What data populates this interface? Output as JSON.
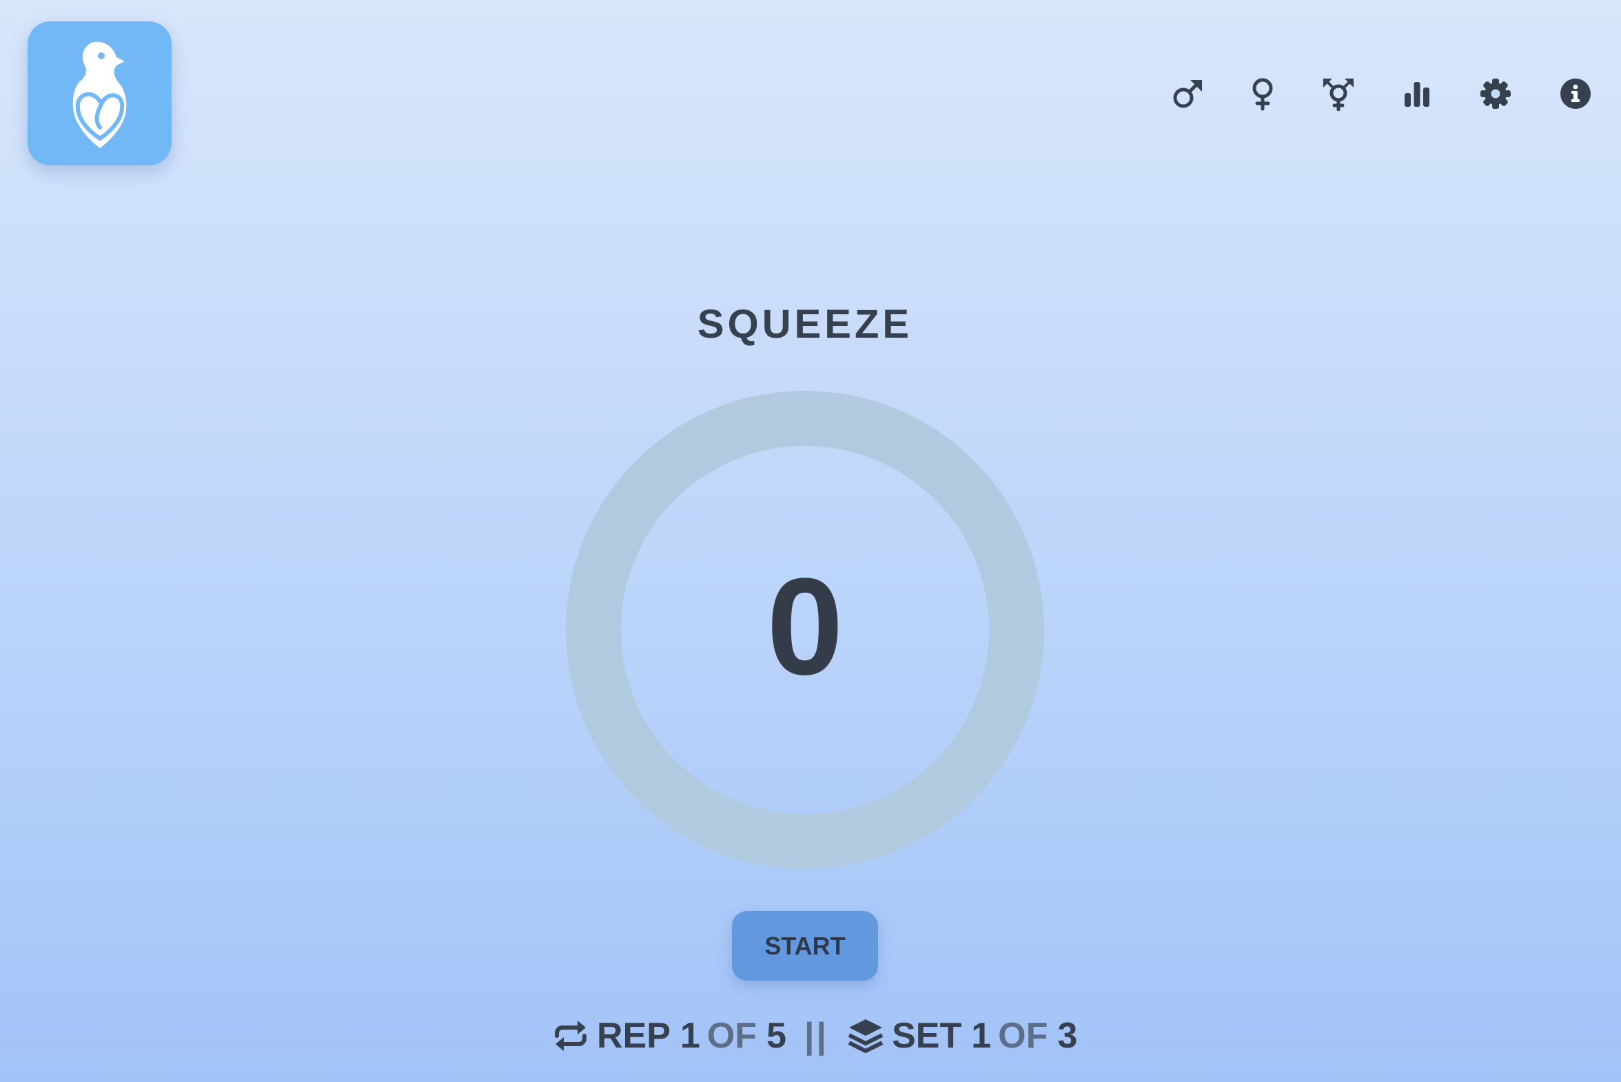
{
  "app": {
    "logo_icon": "dove-heart-logo-icon"
  },
  "nav": {
    "items": [
      {
        "name": "male-icon"
      },
      {
        "name": "female-icon"
      },
      {
        "name": "transgender-icon"
      },
      {
        "name": "stats-chart-icon"
      },
      {
        "name": "gear-icon"
      },
      {
        "name": "info-icon"
      }
    ]
  },
  "exercise": {
    "phase_label": "SQUEEZE",
    "counter_value": "0",
    "start_label": "START"
  },
  "progress": {
    "rep_icon": "repeat-icon",
    "rep_label": "REP",
    "rep_current": "1",
    "rep_of": "OF",
    "rep_total": "5",
    "divider": "||",
    "set_icon": "layers-icon",
    "set_label": "SET",
    "set_current": "1",
    "set_of": "OF",
    "set_total": "3"
  },
  "colors": {
    "logo_tile": "#72b8f6",
    "ring": "#b2cadf",
    "button": "#6298de",
    "text": "#36404f"
  }
}
